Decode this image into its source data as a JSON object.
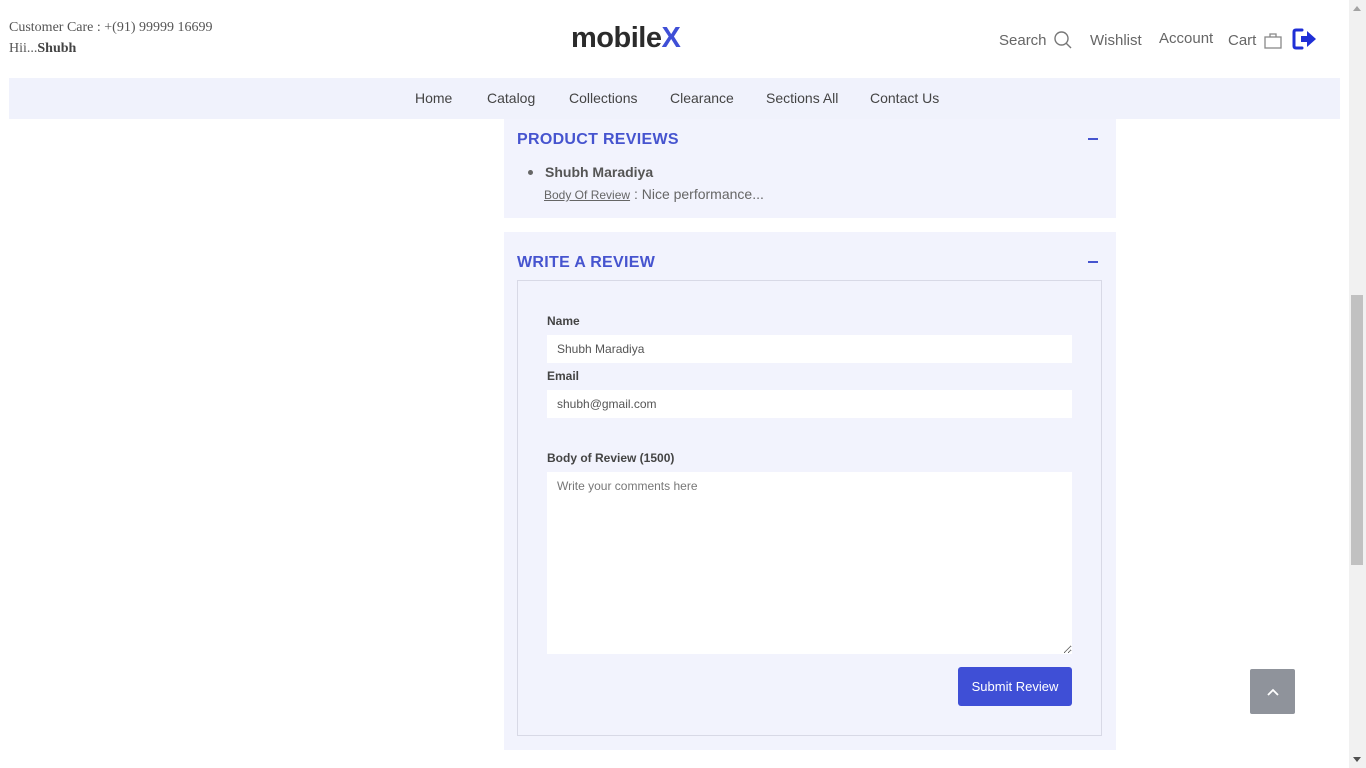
{
  "header": {
    "customer_care": "Customer Care : +(91) 99999 16699",
    "greeting_prefix": "Hii...",
    "greeting_name": "Shubh",
    "logo_main": "mobile",
    "logo_accent": "X",
    "search_label": "Search",
    "wishlist_label": "Wishlist",
    "account_label": "Account",
    "cart_label": "Cart"
  },
  "nav": {
    "items": [
      "Home",
      "Catalog",
      "Collections",
      "Clearance",
      "Sections All",
      "Contact Us"
    ]
  },
  "reviews": {
    "title": "PRODUCT REVIEWS",
    "items": [
      {
        "author": "Shubh Maradiya",
        "body_label": "Body Of Review",
        "body": ": Nice performance..."
      }
    ]
  },
  "write_review": {
    "title": "WRITE A REVIEW",
    "name_label": "Name",
    "name_value": "Shubh Maradiya",
    "email_label": "Email",
    "email_value": "shubh@gmail.com",
    "body_label": "Body of Review (1500)",
    "body_placeholder": "Write your comments here",
    "submit_label": "Submit Review"
  },
  "colors": {
    "accent": "#3f4fd6",
    "panel_bg": "#f2f3fd",
    "nav_bg": "#f0f2fc"
  }
}
